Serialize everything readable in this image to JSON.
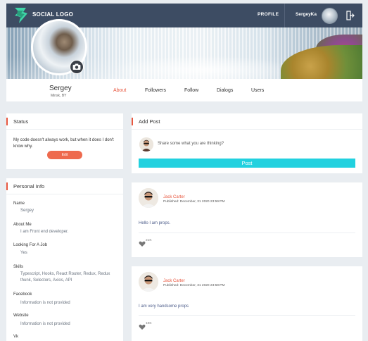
{
  "header": {
    "logo_text": "SOCIAL LOGO",
    "nav_profile": "PROFILE",
    "username": "SergeyKa",
    "colors": {
      "bar": "#3d4c63",
      "logo_green": "#3fd6a8"
    }
  },
  "profile": {
    "name": "Sergey",
    "location": "Minsk, BY",
    "tabs": [
      {
        "label": "About",
        "active": true
      },
      {
        "label": "Followers",
        "active": false
      },
      {
        "label": "Follow",
        "active": false
      },
      {
        "label": "Dialogs",
        "active": false
      },
      {
        "label": "Users",
        "active": false
      }
    ]
  },
  "status": {
    "title": "Status",
    "text": "My code doesn't always work, but when it does I don't know why.",
    "edit_label": "Edit"
  },
  "personal_info": {
    "title": "Personal Info",
    "fields": [
      {
        "label": "Name",
        "value": "Sergey"
      },
      {
        "label": "About Me",
        "value": "I am Front end developer."
      },
      {
        "label": "Looking For A Job",
        "value": "Yes"
      },
      {
        "label": "Skills",
        "value": "Typescript, Hooks, React Router, Redux, Redux thunk, Selectors, Axios, API"
      },
      {
        "label": "Facebook",
        "value": "Information is not provided"
      },
      {
        "label": "Website",
        "value": "Information is not provided"
      },
      {
        "label": "Vk",
        "value": ""
      }
    ]
  },
  "add_post": {
    "title": "Add Post",
    "placeholder": "Share some what you are thinking?",
    "button_label": "Post"
  },
  "posts": [
    {
      "author": "Jack Carter",
      "published": "Published: December, 31 2020 23:59:PM",
      "text": "Hello I am props.",
      "likes": "21K"
    },
    {
      "author": "Jack Carter",
      "published": "Published: December, 31 2020 23:59:PM",
      "text": "I am very handsome props",
      "likes": "10K"
    }
  ],
  "accent": "#e8573f",
  "post_button_color": "#22d1df"
}
